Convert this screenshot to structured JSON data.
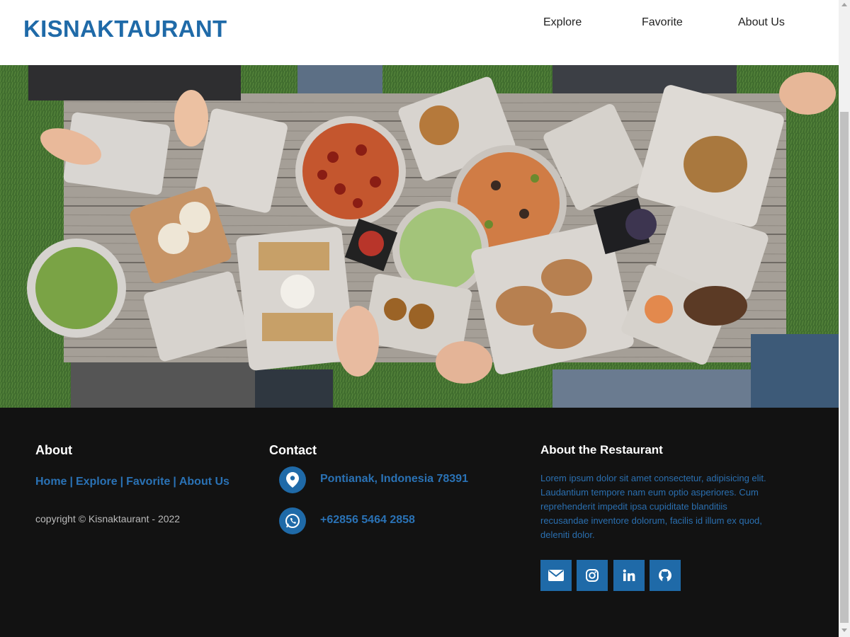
{
  "header": {
    "brand": "KISNAKTAURANT",
    "nav": [
      "Explore",
      "Favorite",
      "About Us"
    ]
  },
  "hero": {
    "image": "food-spread-on-wooden-table"
  },
  "footer": {
    "about": {
      "title": "About",
      "links": [
        "Home",
        "Explore",
        "Favorite",
        "About Us"
      ],
      "separator": "|",
      "copyright": "copyright © Kisnaktaurant - 2022"
    },
    "contact": {
      "title": "Contact",
      "address": "Pontianak, Indonesia 78391",
      "phone": "+62856 5464 2858"
    },
    "restaurant": {
      "title": "About the Restaurant",
      "description": "Lorem ipsum dolor sit amet consectetur, adipisicing elit. Laudantium tempore nam eum optio asperiores. Cum reprehenderit impedit ipsa cupiditate blanditiis recusandae inventore dolorum, facilis id illum ex quod, deleniti dolor.",
      "social": [
        "envelope-icon",
        "instagram-icon",
        "linkedin-icon",
        "github-icon"
      ]
    }
  },
  "colors": {
    "accent": "#1f6aa8",
    "footer_bg": "#121212",
    "link": "#2a72b5"
  }
}
